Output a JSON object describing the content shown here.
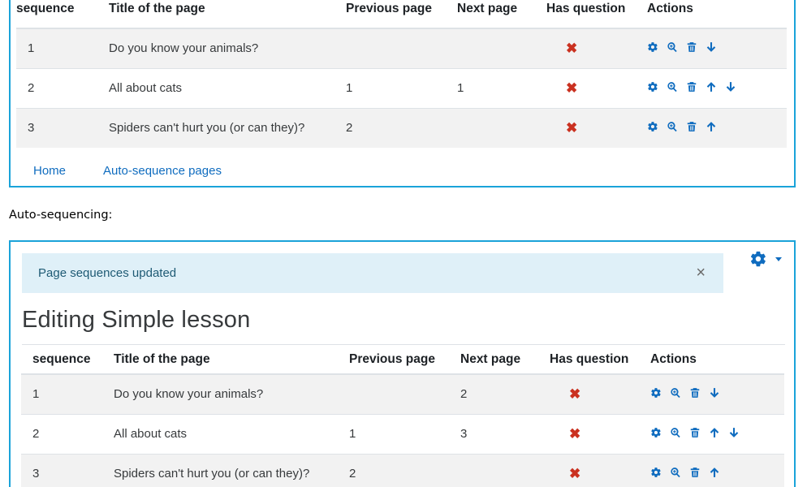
{
  "columns": {
    "sequence": "sequence",
    "title": "Title of the page",
    "previous": "Previous page",
    "next": "Next page",
    "has_question": "Has question",
    "actions": "Actions"
  },
  "table1": {
    "rows": [
      {
        "sequence": "1",
        "title": "Do you know your animals?",
        "previous": "",
        "next": "",
        "has_question": "✖",
        "actions": [
          "settings-icon",
          "zoom-icon",
          "trash-icon",
          "arrow-down-icon"
        ]
      },
      {
        "sequence": "2",
        "title": "All about cats",
        "previous": "1",
        "next": "1",
        "has_question": "✖",
        "actions": [
          "settings-icon",
          "zoom-icon",
          "trash-icon",
          "arrow-up-icon",
          "arrow-down-icon"
        ]
      },
      {
        "sequence": "3",
        "title": "Spiders can't hurt you (or can they)?",
        "previous": "2",
        "next": "",
        "has_question": "✖",
        "actions": [
          "settings-icon",
          "zoom-icon",
          "trash-icon",
          "arrow-up-icon"
        ]
      }
    ],
    "links": {
      "home": "Home",
      "auto_sequence": "Auto-sequence pages"
    }
  },
  "section_label": "Auto-sequencing:",
  "panel2": {
    "alert": {
      "message": "Page sequences updated",
      "close": "×"
    },
    "settings_menu_icon": "gear-icon",
    "title": "Editing Simple lesson"
  },
  "table2": {
    "rows": [
      {
        "sequence": "1",
        "title": "Do you know your animals?",
        "previous": "",
        "next": "2",
        "has_question": "✖",
        "actions": [
          "settings-icon",
          "zoom-icon",
          "trash-icon",
          "arrow-down-icon"
        ]
      },
      {
        "sequence": "2",
        "title": "All about cats",
        "previous": "1",
        "next": "3",
        "has_question": "✖",
        "actions": [
          "settings-icon",
          "zoom-icon",
          "trash-icon",
          "arrow-up-icon",
          "arrow-down-icon"
        ]
      },
      {
        "sequence": "3",
        "title": "Spiders can't hurt you (or can they)?",
        "previous": "2",
        "next": "",
        "has_question": "✖",
        "actions": [
          "settings-icon",
          "zoom-icon",
          "trash-icon",
          "arrow-up-icon"
        ]
      }
    ]
  },
  "colors": {
    "accent": "#0f6cbf",
    "border": "#1aa3d9",
    "cross": "#ca3120",
    "alert_bg": "#dff0f8"
  }
}
